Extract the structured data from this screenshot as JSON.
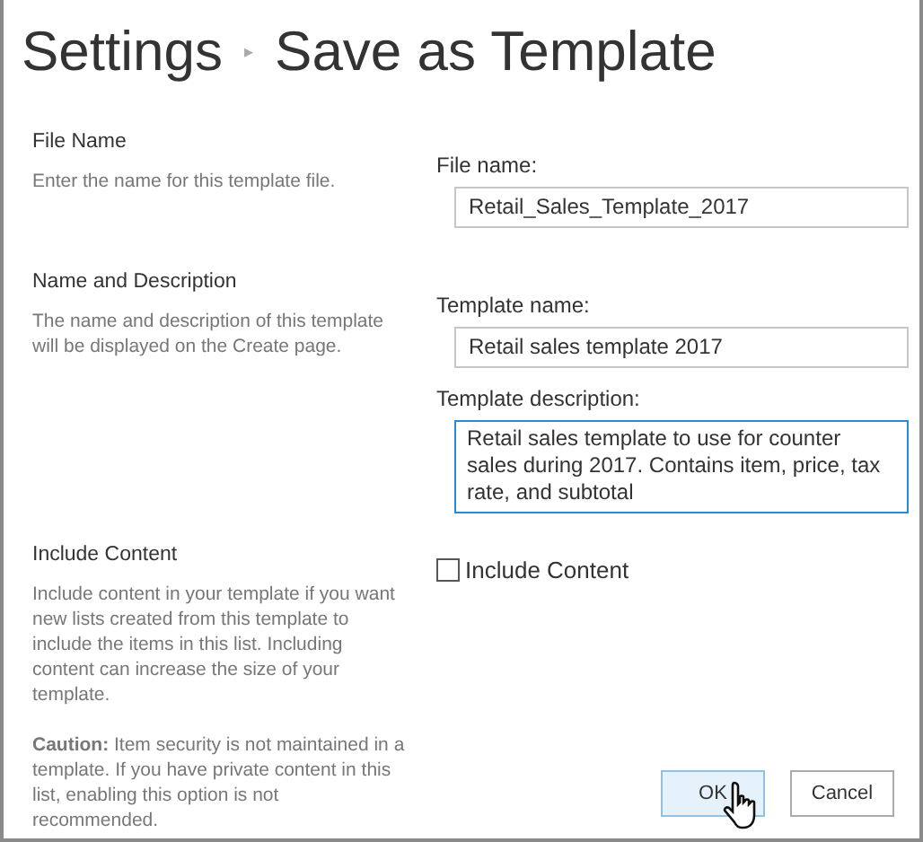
{
  "breadcrumb": {
    "parent": "Settings",
    "separator": "▸",
    "current": "Save as Template"
  },
  "sections": [
    {
      "kind": "fields",
      "title": "File Name",
      "description": "Enter the name for this template file.",
      "fields": [
        {
          "kind": "input",
          "label": "File name:",
          "value": "Retail_Sales_Template_2017",
          "focused": false
        }
      ]
    },
    {
      "kind": "fields",
      "title": "Name and Description",
      "description": "The name and description of this template will be displayed on the Create page.",
      "fields": [
        {
          "kind": "input",
          "label": "Template name:",
          "value": "Retail sales template 2017",
          "focused": false
        },
        {
          "kind": "textarea",
          "label": "Template description:",
          "value": "Retail sales template to use for counter sales during 2017. Contains item, price, tax rate, and subtotal",
          "focused": true
        }
      ]
    },
    {
      "kind": "checkbox",
      "title": "Include Content",
      "description": "Include content in your template if you want new lists created from this template to include the items in this list. Including content can increase the size of your template.",
      "caution": "**Caution:** Item security is not maintained in a template. If you have private content in this list, enabling this option is not recommended.",
      "checkbox": {
        "label": "Include Content",
        "checked": false
      }
    }
  ],
  "buttons": [
    {
      "label": "OK",
      "hovered": true
    },
    {
      "label": "Cancel",
      "hovered": false
    }
  ]
}
